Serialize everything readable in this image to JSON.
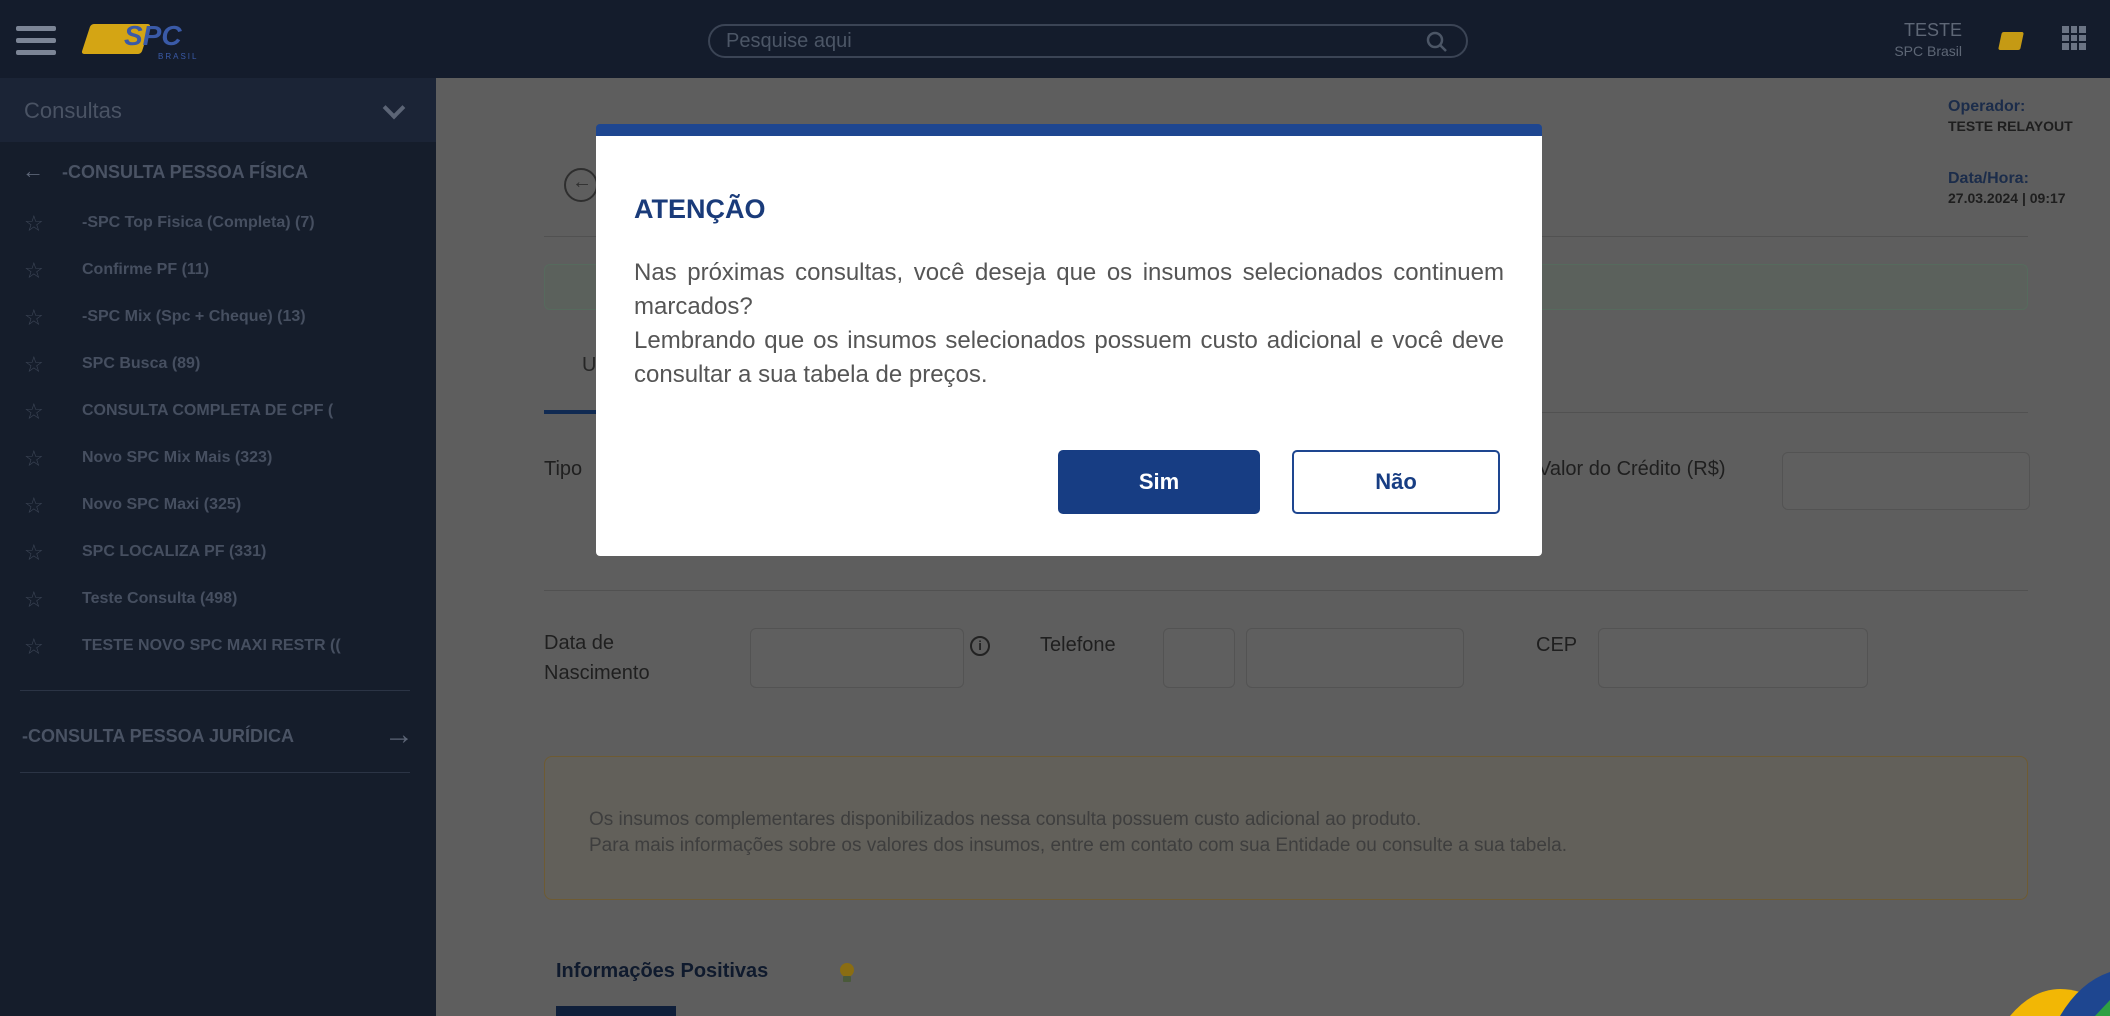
{
  "header": {
    "logo_text": "SPC",
    "logo_sub": "BRASIL",
    "search_placeholder": "Pesquise aqui",
    "user_name": "TESTE",
    "user_org": "SPC Brasil"
  },
  "sidebar": {
    "header_title": "Consultas",
    "section_pf": "-CONSULTA PESSOA FÍSICA",
    "items": [
      {
        "label": "-SPC Top Fisica (Completa) (7)"
      },
      {
        "label": "Confirme PF (11)"
      },
      {
        "label": "-SPC Mix (Spc + Cheque) (13)"
      },
      {
        "label": "SPC Busca (89)"
      },
      {
        "label": "CONSULTA COMPLETA DE CPF ("
      },
      {
        "label": "Novo SPC Mix Mais (323)"
      },
      {
        "label": "Novo SPC Maxi (325)"
      },
      {
        "label": "SPC LOCALIZA PF (331)"
      },
      {
        "label": "Teste Consulta (498)"
      },
      {
        "label": "TESTE NOVO SPC MAXI RESTR (("
      }
    ],
    "section_pj": "-CONSULTA PESSOA JURÍDICA"
  },
  "main": {
    "operator_label": "Operador:",
    "operator_value": "TESTE RELAYOUT",
    "datetime_label": "Data/Hora:",
    "datetime_value": "27.03.2024 | 09:17",
    "tab_letter": "U",
    "tipo_label": "Tipo",
    "valor_credito_label": "Valor do Crédito (R$)",
    "data_nascimento_label": "Data de Nascimento",
    "info_symbol": "i",
    "telefone_label": "Telefone",
    "cep_label": "CEP",
    "notice_line1": "Os insumos complementares disponibilizados nessa consulta possuem custo adicional ao produto.",
    "notice_line2": "Para mais informações sobre os valores dos insumos, entre em contato com sua Entidade ou consulte a sua tabela.",
    "positive_title": "Informações Positivas"
  },
  "modal": {
    "title": "ATENÇÃO",
    "message": "Nas próximas consultas, você deseja que os insumos selecionados continuem marcados? Lembrando que os insumos selecionados possuem custo adicional e você deve consultar a sua tabela de preços.",
    "message_line1": "Nas próximas consultas, você deseja que os insumos selecionados continuem marcados?",
    "message_line2": "Lembrando que os insumos selecionados possuem custo adicional e você deve consultar a sua tabela de preços.",
    "yes_label": "Sim",
    "no_label": "Não"
  },
  "colors": {
    "topbar": "#141c2c",
    "modal_accent": "#1e4690",
    "primary_button": "#173d83",
    "brand_yellow": "#d4a514"
  }
}
